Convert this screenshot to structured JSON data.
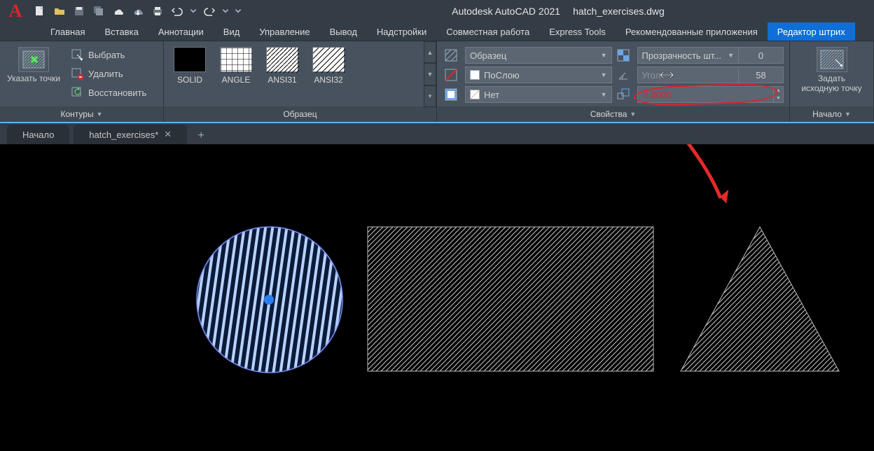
{
  "title": {
    "app": "Autodesk AutoCAD 2021",
    "file": "hatch_exercises.dwg"
  },
  "menu": {
    "items": [
      "Главная",
      "Вставка",
      "Аннотации",
      "Вид",
      "Управление",
      "Вывод",
      "Надстройки",
      "Совместная работа",
      "Express Tools",
      "Рекомендованные приложения",
      "Редактор штрих"
    ],
    "active_index": 10
  },
  "ribbon": {
    "boundaries": {
      "pick_points": "Указать точки",
      "select": "Выбрать",
      "remove": "Удалить",
      "recreate": "Восстановить",
      "panel_title": "Контуры"
    },
    "pattern": {
      "items": [
        {
          "name": "SOLID",
          "fill": "#000"
        },
        {
          "name": "ANGLE",
          "fill": "grid"
        },
        {
          "name": "ANSI31",
          "fill": "diag"
        },
        {
          "name": "ANSI32",
          "fill": "diag2"
        }
      ],
      "panel_title": "Образец"
    },
    "props": {
      "type": "Образец",
      "color": "ПоСлою",
      "bg": "Нет",
      "transparency_label": "Прозрачность шт...",
      "transparency_value": "0",
      "angle_label": "Угол",
      "angle_value": "58",
      "scale_value": "3.0000",
      "panel_title": "Свойства"
    },
    "origin": {
      "label_line1": "Задать",
      "label_line2": "исходную точку",
      "panel_title": "Начало"
    }
  },
  "doctabs": {
    "start": "Начало",
    "file": "hatch_exercises*"
  },
  "logo_letter": "A"
}
